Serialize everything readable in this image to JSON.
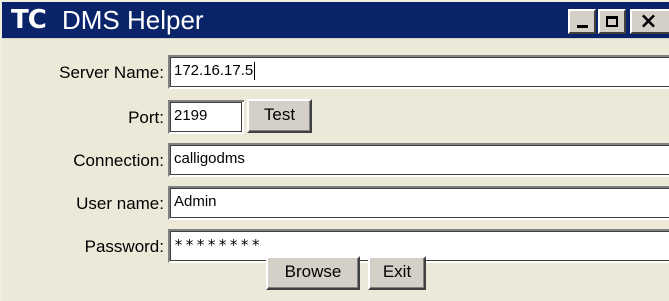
{
  "window": {
    "logo_text": "TC",
    "title": "DMS Helper",
    "controls": {
      "minimize_icon": "minimize-icon",
      "maximize_icon": "maximize-icon",
      "close_icon": "close-icon"
    }
  },
  "form": {
    "server_name": {
      "label": "Server Name:",
      "value": "172.16.17.5"
    },
    "port": {
      "label": "Port:",
      "value": "2199"
    },
    "test_button": "Test",
    "connection": {
      "label": "Connection:",
      "value": "calligodms"
    },
    "user_name": {
      "label": "User name:",
      "value": "Admin"
    },
    "password": {
      "label": "Password:",
      "value": "********"
    }
  },
  "actions": {
    "browse_button": "Browse",
    "exit_button": "Exit"
  },
  "colors": {
    "titlebar": "#0a246a",
    "face": "#d4d0c8",
    "window_bg": "#ece9d8"
  }
}
